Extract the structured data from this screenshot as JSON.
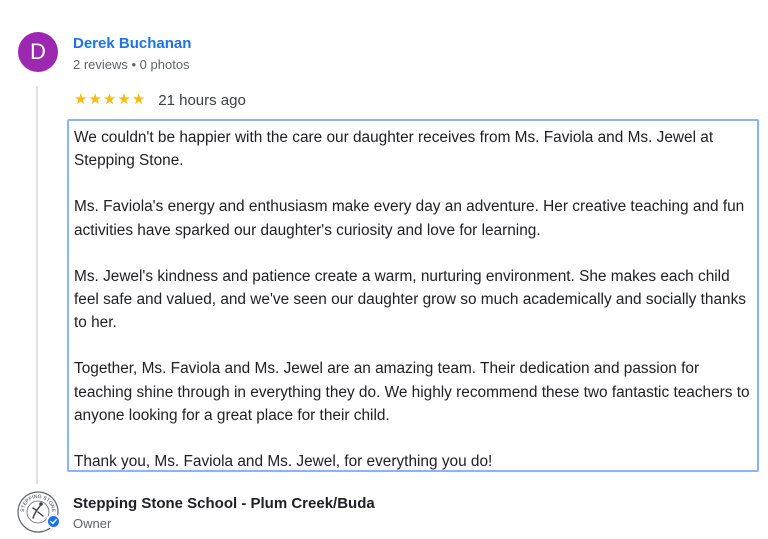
{
  "review": {
    "avatar_letter": "D",
    "author": "Derek Buchanan",
    "meta": "2 reviews • 0 photos",
    "rating": 5,
    "time": "21 hours ago",
    "paragraphs": [
      "We couldn't be happier with the care our daughter receives from Ms. Faviola and Ms. Jewel at Stepping Stone.",
      "Ms. Faviola's energy and enthusiasm make every day an adventure. Her creative teaching and fun activities have sparked our daughter's curiosity and love for learning.",
      "Ms. Jewel's kindness and patience create a warm, nurturing environment. She makes each child feel safe and valued, and we've seen our daughter grow so much academically and socially thanks to her.",
      "Together, Ms. Faviola and Ms. Jewel are an amazing team. Their dedication and passion for teaching shine through in everything they do. We highly recommend these two fantastic teachers to anyone looking for a great place for their child.",
      "Thank you, Ms. Faviola and Ms. Jewel, for everything you do!"
    ]
  },
  "owner": {
    "name": "Stepping Stone School - Plum Creek/Buda",
    "role": "Owner",
    "logo_text": "STEPPING STONE SCHOOL"
  },
  "colors": {
    "avatar": "#9c27b0",
    "link": "#1a73e8",
    "star": "#fbbc04",
    "selection_border": "#8ab4f8"
  },
  "icons": {
    "star": "star-icon",
    "verified": "verified-check-icon",
    "logo": "school-logo-icon"
  }
}
